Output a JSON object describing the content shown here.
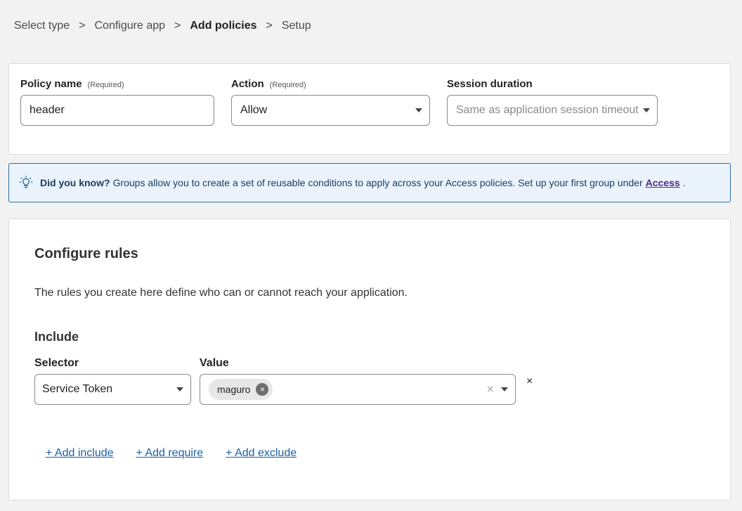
{
  "breadcrumb": {
    "items": [
      "Select type",
      "Configure app",
      "Add policies",
      "Setup"
    ],
    "separator": ">",
    "active_index": 2
  },
  "policy": {
    "name_label": "Policy name",
    "name_required": "(Required)",
    "name_value": "header",
    "action_label": "Action",
    "action_required": "(Required)",
    "action_value": "Allow",
    "session_label": "Session duration",
    "session_placeholder": "Same as application session timeout"
  },
  "info": {
    "icon": "lightbulb-icon",
    "lead": "Did you know?",
    "text": "Groups allow you to create a set of reusable conditions to apply across your Access policies. Set up your first group under",
    "link": "Access",
    "tail": "."
  },
  "rules": {
    "title": "Configure rules",
    "description": "The rules you create here define who can or cannot reach your application.",
    "include_title": "Include",
    "selector_label": "Selector",
    "value_label": "Value",
    "selector_value": "Service Token",
    "chip_value": "maguro",
    "chip_remove": "×",
    "clear_symbol": "×",
    "remove_symbol": "×",
    "add_include": "+ Add include",
    "add_require": "+ Add require",
    "add_exclude": "+ Add exclude"
  },
  "colors": {
    "info_bg": "#eaf3fc",
    "info_border": "#2c6ea7",
    "link": "#1d5fa8"
  }
}
